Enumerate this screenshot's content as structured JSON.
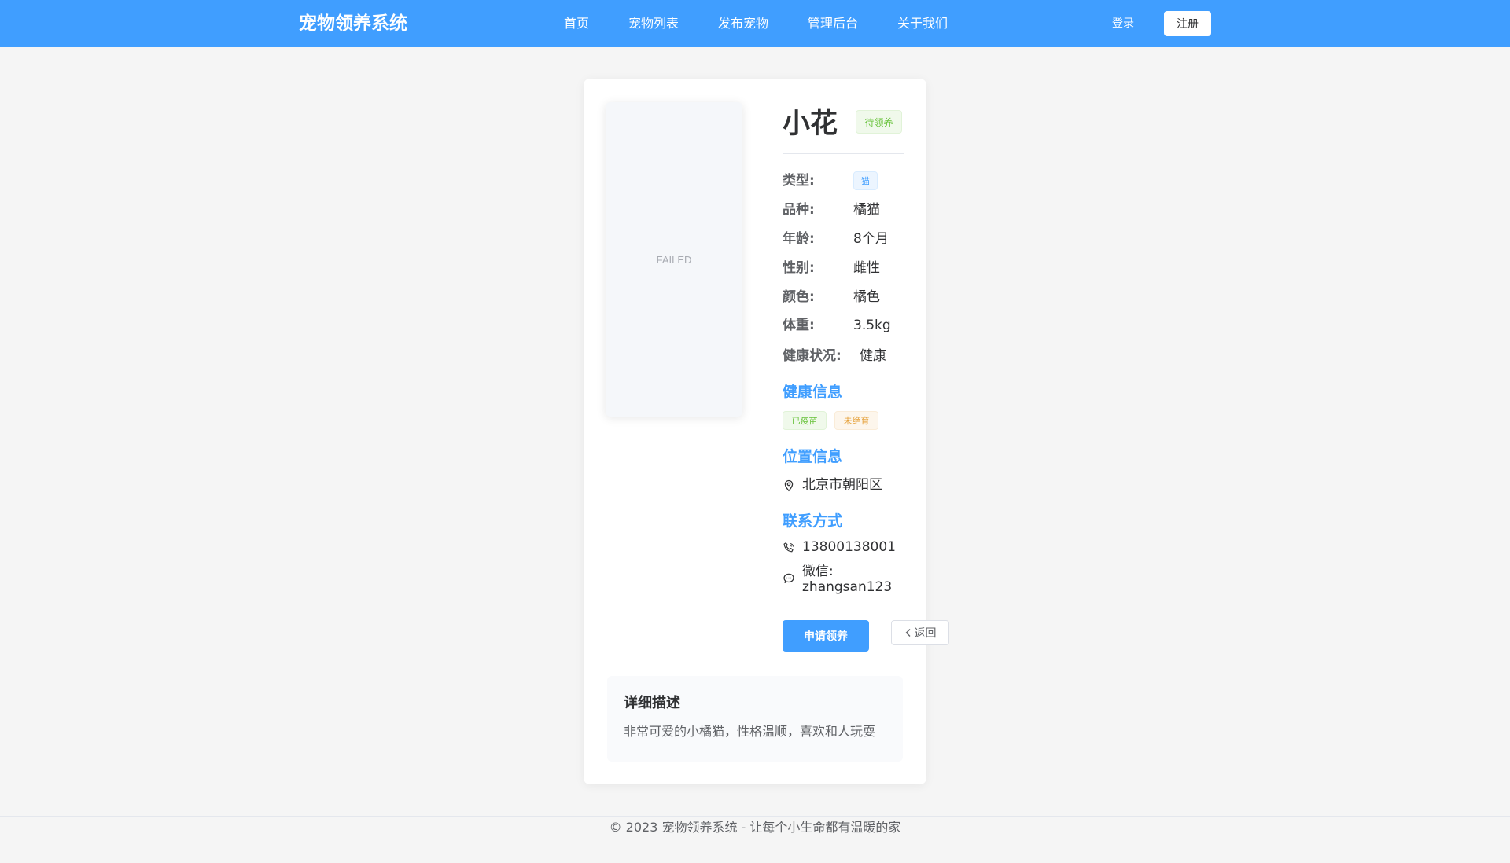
{
  "header": {
    "brand": "宠物领养系统",
    "nav": [
      {
        "label": "首页"
      },
      {
        "label": "宠物列表"
      },
      {
        "label": "发布宠物"
      },
      {
        "label": "管理后台"
      },
      {
        "label": "关于我们"
      }
    ],
    "login": "登录",
    "register": "注册"
  },
  "pet": {
    "image_alt": "FAILED",
    "name": "小花",
    "status": "待领养",
    "fields": {
      "type_label": "类型:",
      "type_value": "猫",
      "breed_label": "品种:",
      "breed_value": "橘猫",
      "age_label": "年龄:",
      "age_value": "8个月",
      "gender_label": "性别:",
      "gender_value": "雌性",
      "color_label": "颜色:",
      "color_value": "橘色",
      "weight_label": "体重:",
      "weight_value": "3.5kg",
      "health_label": "健康状况:",
      "health_value": "健康"
    },
    "health_section": {
      "title": "健康信息",
      "tags": [
        "已疫苗",
        "未绝育"
      ]
    },
    "location_section": {
      "title": "位置信息",
      "address": "北京市朝阳区"
    },
    "contact_section": {
      "title": "联系方式",
      "phone": "13800138001",
      "wechat_line1": "微信:",
      "wechat_line2": "zhangsan123"
    },
    "actions": {
      "apply": "申请领养",
      "back": "返回"
    },
    "description": {
      "title": "详细描述",
      "text": "非常可爱的小橘猫，性格温顺，喜欢和人玩耍"
    }
  },
  "footer": {
    "text": "© 2023 宠物领养系统 - 让每个小生命都有温暖的家"
  },
  "colors": {
    "primary": "#409eff",
    "success": "#67c23a",
    "warning": "#e6a23c",
    "page_bg": "#f5f5f5"
  }
}
